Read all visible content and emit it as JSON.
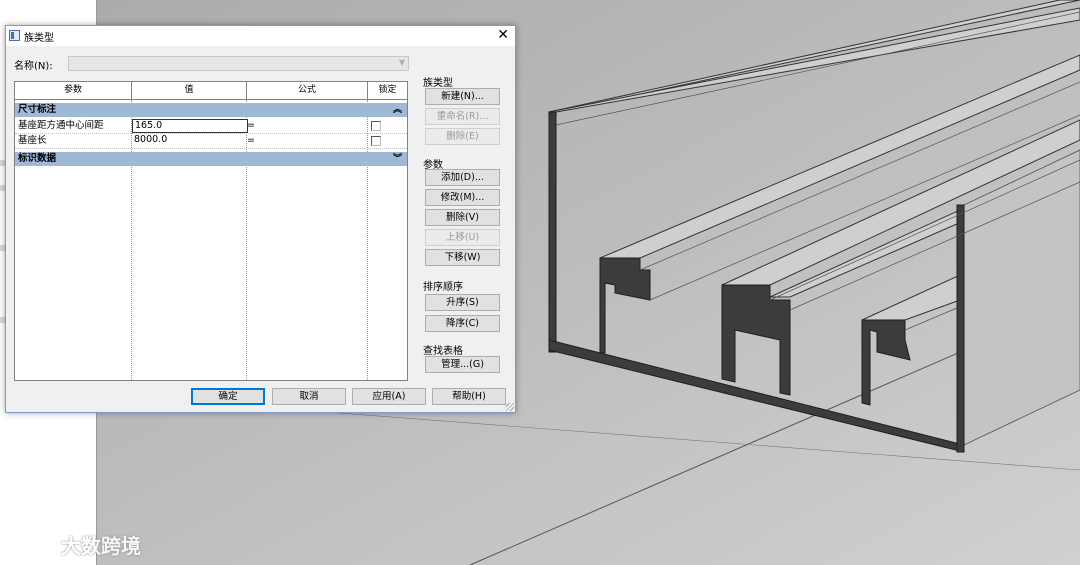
{
  "dialog": {
    "title": "族类型",
    "close_glyph": "✕",
    "name_label": "名称(N):",
    "name_value": ""
  },
  "grid": {
    "headers": [
      "参数",
      "值",
      "公式",
      "锁定"
    ],
    "groups": [
      {
        "label": "尺寸标注",
        "chevron": "︽",
        "rows": [
          {
            "param": "基座距方通中心间距",
            "value": "165.0",
            "formula": "=",
            "locked": false
          },
          {
            "param": "基座长",
            "value": "8000.0",
            "formula": "=",
            "locked": false
          }
        ]
      },
      {
        "label": "标识数据",
        "chevron": "︾",
        "rows": []
      }
    ]
  },
  "sidebar": {
    "family_types": {
      "label": "族类型",
      "buttons": [
        {
          "label": "新建(N)...",
          "enabled": true
        },
        {
          "label": "重命名(R)...",
          "enabled": false
        },
        {
          "label": "删除(E)",
          "enabled": false
        }
      ]
    },
    "parameters": {
      "label": "参数",
      "buttons": [
        {
          "label": "添加(D)...",
          "enabled": true
        },
        {
          "label": "修改(M)...",
          "enabled": true
        },
        {
          "label": "删除(V)",
          "enabled": true
        },
        {
          "label": "上移(U)",
          "enabled": false
        },
        {
          "label": "下移(W)",
          "enabled": true
        }
      ]
    },
    "sort_order": {
      "label": "排序顺序",
      "buttons": [
        {
          "label": "升序(S)",
          "enabled": true
        },
        {
          "label": "降序(C)",
          "enabled": true
        }
      ]
    },
    "lookup_tables": {
      "label": "查找表格",
      "buttons": [
        {
          "label": "管理...(G)",
          "enabled": true
        }
      ]
    }
  },
  "footer": {
    "ok": "确定",
    "cancel": "取消",
    "apply": "应用(A)",
    "help": "帮助(H)"
  },
  "watermark": {
    "text": "大数跨境"
  },
  "colors": {
    "group_header": "#9eb8d6",
    "dialog_bg": "#f0f0f0",
    "viewport_bg": "#bdbdbd",
    "profile_face": "#3c3c3c"
  }
}
